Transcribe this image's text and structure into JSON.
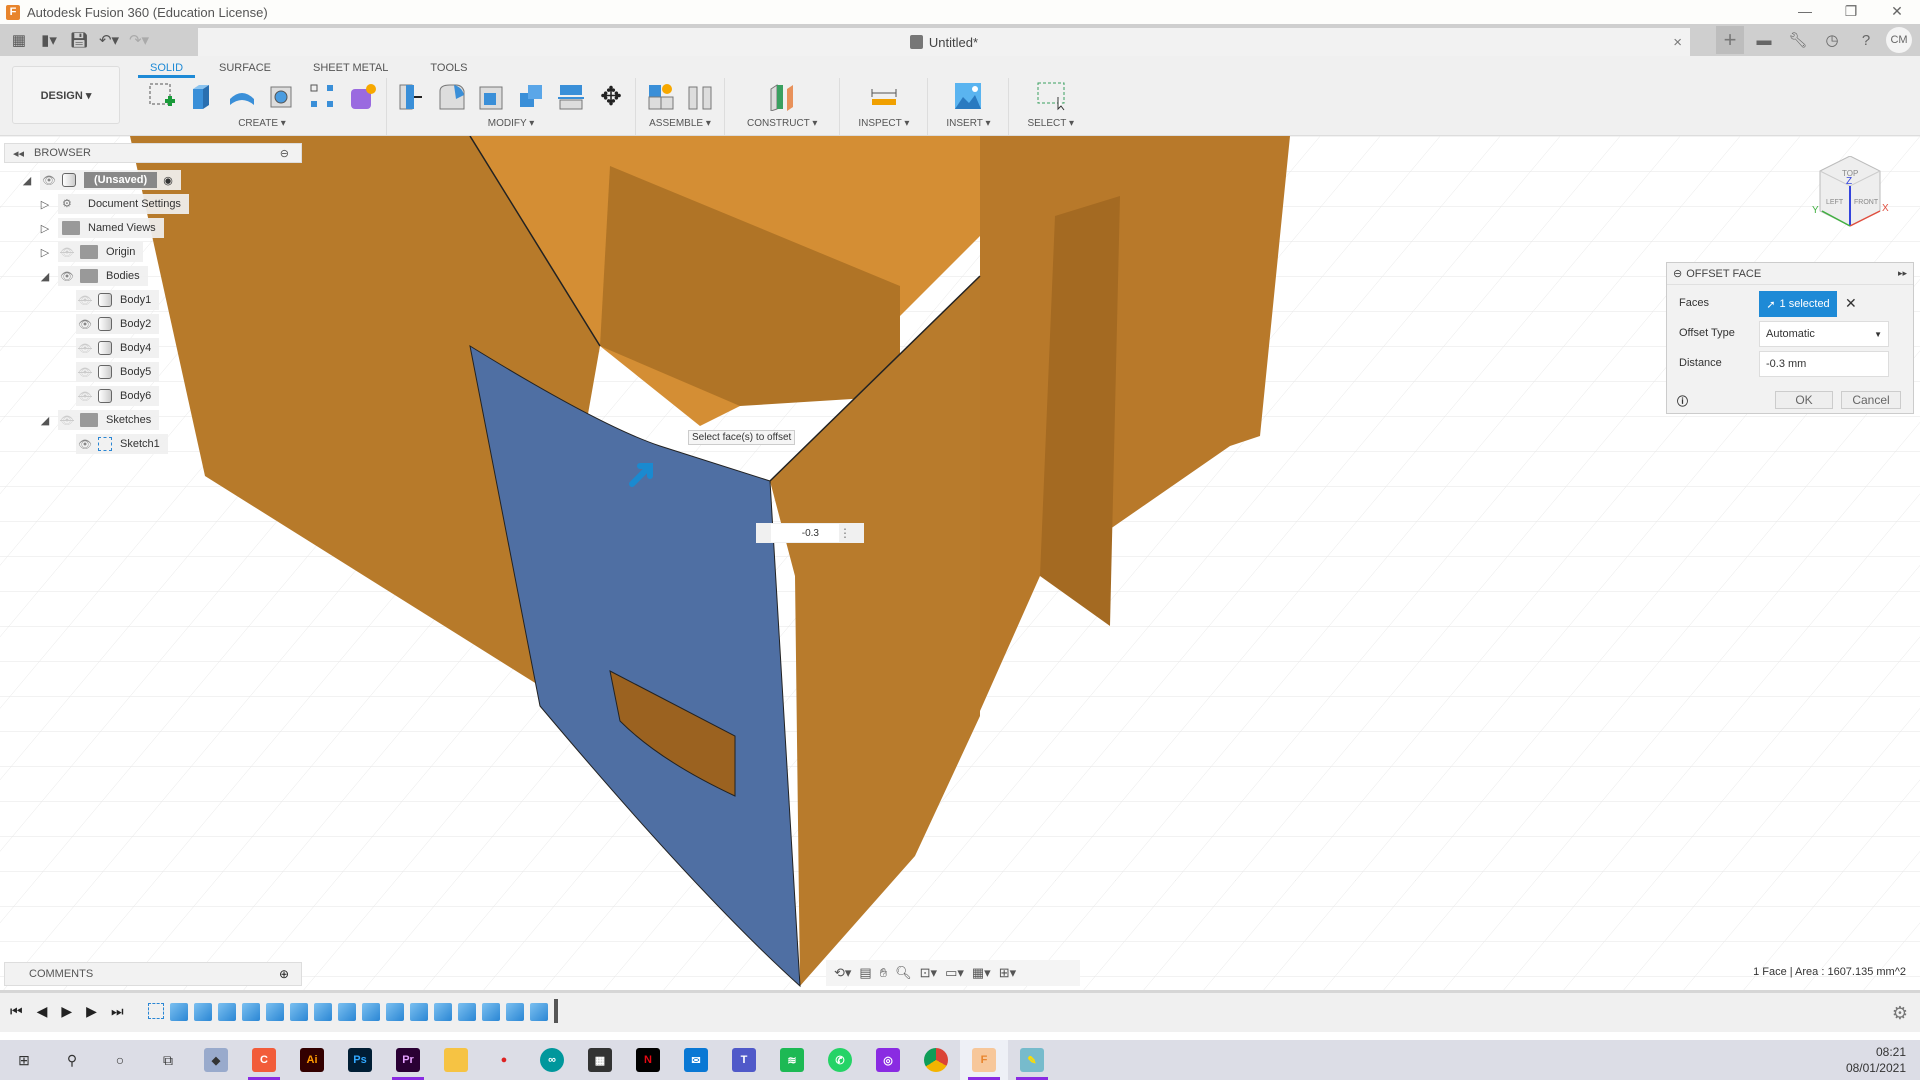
{
  "window": {
    "title": "Autodesk Fusion 360 (Education License)",
    "controls": [
      "minimize",
      "restore",
      "close"
    ]
  },
  "quick_access": {
    "icons": [
      "apps-grid-icon",
      "file-icon",
      "save-icon",
      "undo-icon",
      "redo-icon"
    ]
  },
  "document_tab": {
    "title": "Untitled*",
    "close_label": "×"
  },
  "account": {
    "initials": "CM",
    "icons": [
      "new-tab-icon",
      "comment-icon",
      "extensions-icon",
      "job-status-icon",
      "help-icon"
    ]
  },
  "workspace": {
    "label": "DESIGN ▾"
  },
  "ribbon_tabs": [
    {
      "label": "SOLID",
      "active": true
    },
    {
      "label": "SURFACE"
    },
    {
      "label": "SHEET METAL"
    },
    {
      "label": "TOOLS"
    }
  ],
  "ribbon_groups": [
    {
      "label": "CREATE ▾",
      "tools": [
        "create-sketch",
        "extrude",
        "revolve",
        "hole",
        "pattern",
        "create-form"
      ]
    },
    {
      "label": "MODIFY ▾",
      "tools": [
        "press-pull",
        "fillet",
        "shell",
        "combine",
        "split-body",
        "move"
      ]
    },
    {
      "label": "ASSEMBLE ▾",
      "tools": [
        "new-component",
        "joint"
      ]
    },
    {
      "label": "CONSTRUCT ▾",
      "tools": [
        "offset-plane"
      ]
    },
    {
      "label": "INSPECT ▾",
      "tools": [
        "measure"
      ]
    },
    {
      "label": "INSERT ▾",
      "tools": [
        "insert-image"
      ]
    },
    {
      "label": "SELECT ▾",
      "tools": [
        "window-select"
      ]
    }
  ],
  "browser": {
    "title": "BROWSER",
    "root": "(Unsaved)",
    "items": [
      {
        "label": "Document Settings",
        "type": "settings"
      },
      {
        "label": "Named Views",
        "type": "folder"
      },
      {
        "label": "Origin",
        "type": "folder",
        "visible": false
      },
      {
        "label": "Bodies",
        "type": "folder",
        "visible": true,
        "expanded": true
      },
      {
        "label": "Body1",
        "type": "body",
        "visible": false
      },
      {
        "label": "Body2",
        "type": "body",
        "visible": true
      },
      {
        "label": "Body4",
        "type": "body",
        "visible": false
      },
      {
        "label": "Body5",
        "type": "body",
        "visible": false
      },
      {
        "label": "Body6",
        "type": "body",
        "visible": false
      },
      {
        "label": "Sketches",
        "type": "folder",
        "visible": false,
        "expanded": true
      },
      {
        "label": "Sketch1",
        "type": "sketch",
        "visible": true
      }
    ]
  },
  "offset_face_dialog": {
    "title": "OFFSET FACE",
    "faces_label": "Faces",
    "faces_value": "1 selected",
    "offset_type_label": "Offset Type",
    "offset_type_value": "Automatic",
    "distance_label": "Distance",
    "distance_value": "-0.3 mm",
    "ok_label": "OK",
    "cancel_label": "Cancel"
  },
  "canvas": {
    "tooltip": "Select face(s) to offset",
    "inline_value": "-0.3",
    "selected_face_color": "#4f6fa3",
    "body_color": "#c8862e"
  },
  "viewcube": {
    "top": "TOP",
    "left": "LEFT",
    "front": "FRONT",
    "axes": [
      "X",
      "Y",
      "Z"
    ]
  },
  "comments": {
    "title": "COMMENTS"
  },
  "status": {
    "text": "1 Face | Area : 1607.135 mm^2"
  },
  "timeline": {
    "feature_count": 16
  },
  "taskbar": {
    "apps": [
      "start",
      "search",
      "cortana",
      "task-view",
      "app-1",
      "app-2",
      "illustrator",
      "photoshop",
      "premiere",
      "file-explorer",
      "app-3",
      "arduino",
      "store",
      "netflix",
      "mail",
      "teams",
      "spotify",
      "whatsapp",
      "app-4",
      "chrome",
      "fusion-360",
      "app-5"
    ],
    "time": "08:21",
    "date": "08/01/2021"
  }
}
